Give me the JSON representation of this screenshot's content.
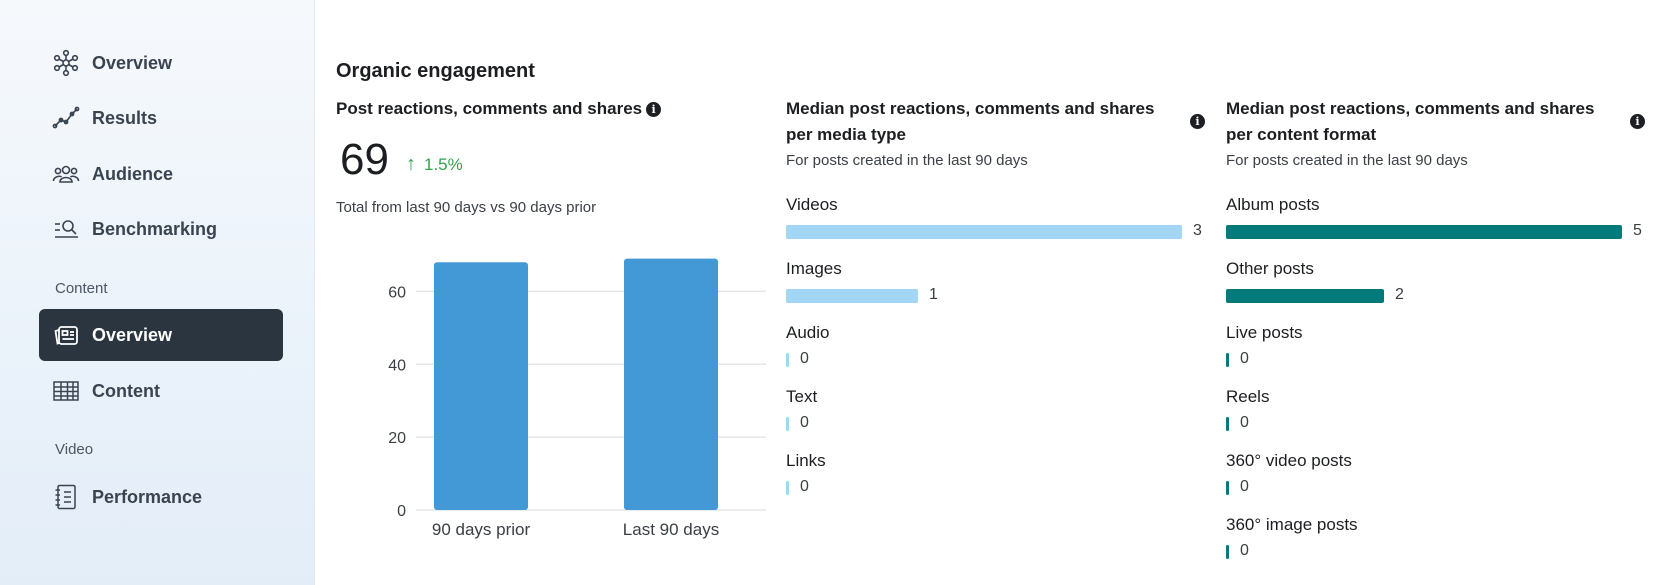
{
  "colors": {
    "active_nav_bg": "#2a3540",
    "bar_blue": "#4299d6",
    "light_blue": "#a3d6f5",
    "teal": "#007a7a",
    "positive_green": "#31a24c"
  },
  "sidebar": {
    "items": [
      {
        "label": "Overview",
        "icon": "network-icon"
      },
      {
        "label": "Results",
        "icon": "trend-line-icon"
      },
      {
        "label": "Audience",
        "icon": "people-icon"
      },
      {
        "label": "Benchmarking",
        "icon": "search-list-icon"
      }
    ],
    "content_section": {
      "label": "Content",
      "items": [
        {
          "label": "Overview",
          "icon": "content-overview-icon",
          "active": true
        },
        {
          "label": "Content",
          "icon": "table-icon"
        }
      ]
    },
    "video_section": {
      "label": "Video",
      "items": [
        {
          "label": "Performance",
          "icon": "notebook-icon"
        }
      ]
    }
  },
  "main": {
    "heading": "Organic engagement",
    "card1": {
      "title": "Post reactions, comments and shares",
      "value": "69",
      "change": "1.5%",
      "subtitle": "Total from last 90 days vs 90 days prior"
    },
    "card2": {
      "title_line1": "Median post reactions, comments and shares",
      "title_line2": "per media type",
      "subtitle": "For posts created in the last 90 days"
    },
    "card3": {
      "title_line1": "Median post reactions, comments and shares",
      "title_line2": "per content format",
      "subtitle": "For posts created in the last 90 days"
    }
  },
  "chart_data": [
    {
      "type": "bar",
      "title": "",
      "categories": [
        "90 days prior",
        "Last 90 days"
      ],
      "values": [
        68,
        69
      ],
      "ylim": [
        0,
        70
      ],
      "yticks": [
        "0",
        "20",
        "40",
        "60"
      ],
      "grid": true,
      "color": "#4299d6"
    },
    {
      "type": "bar",
      "orientation": "horizontal",
      "categories": [
        "Videos",
        "Images",
        "Audio",
        "Text",
        "Links"
      ],
      "values": [
        3,
        1,
        0,
        0,
        0
      ],
      "value_labels": [
        "3",
        "1",
        "0",
        "0",
        "0"
      ],
      "color": "#a3d6f5"
    },
    {
      "type": "bar",
      "orientation": "horizontal",
      "categories": [
        "Album posts",
        "Other posts",
        "Live posts",
        "Reels",
        "360° video posts",
        "360° image posts"
      ],
      "values": [
        5,
        2,
        0,
        0,
        0,
        0
      ],
      "value_labels": [
        "5",
        "2",
        "0",
        "0",
        "0",
        "0"
      ],
      "color": "#007a7a"
    }
  ]
}
